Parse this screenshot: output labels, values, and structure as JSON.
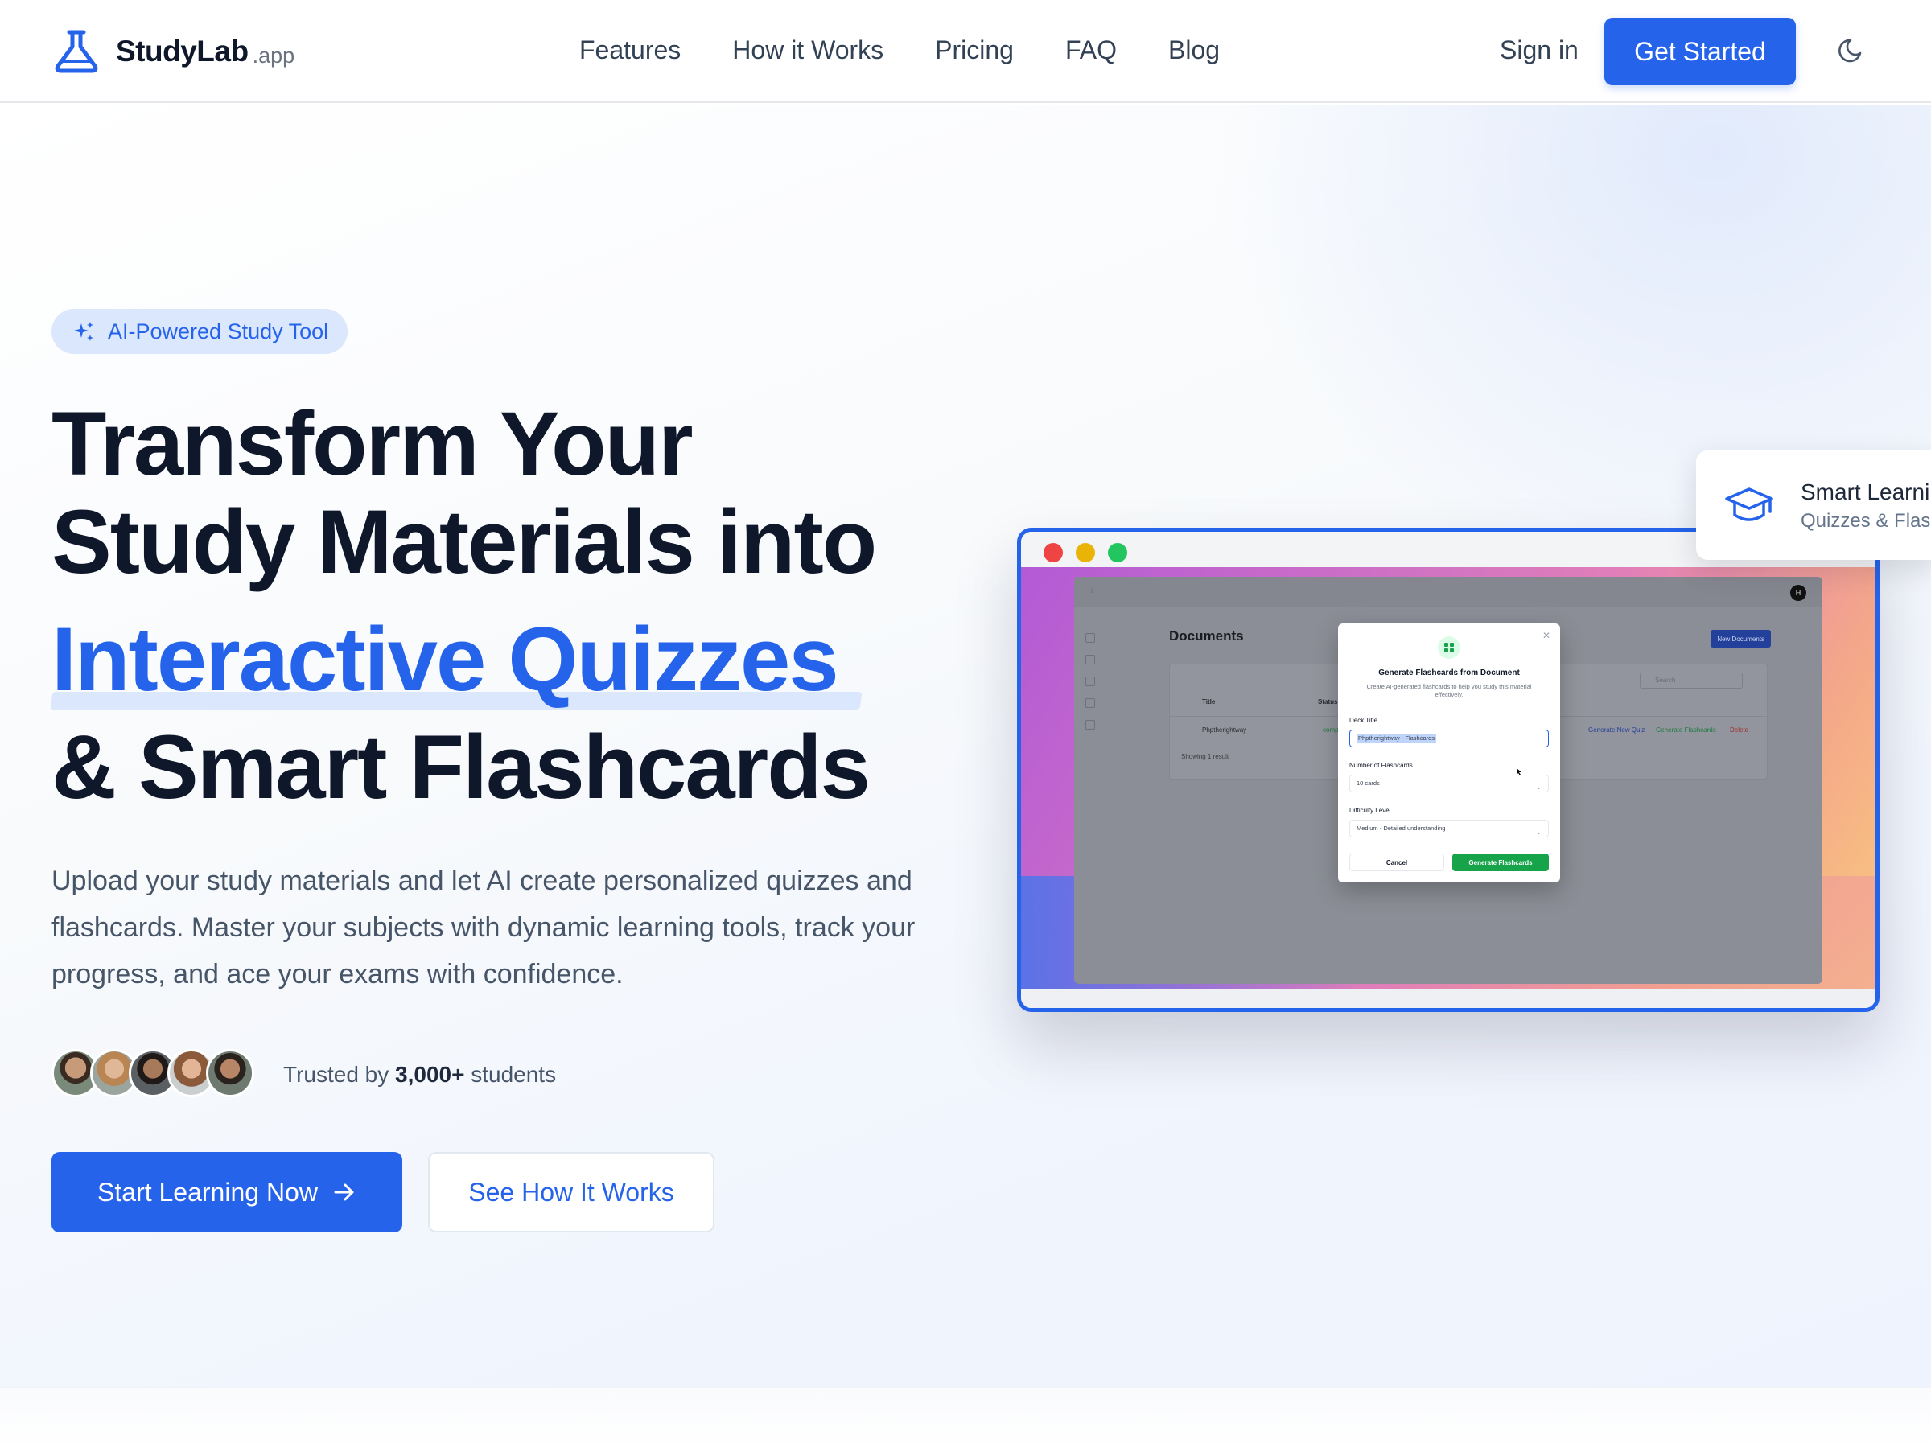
{
  "brand": {
    "name": "StudyLab",
    "tld": ".app"
  },
  "nav": {
    "links": [
      "Features",
      "How it Works",
      "Pricing",
      "FAQ",
      "Blog"
    ],
    "signin": "Sign in",
    "cta": "Get Started"
  },
  "hero": {
    "badge": "AI-Powered Study Tool",
    "title_line1": "Transform Your",
    "title_line2": "Study Materials into",
    "title_highlight": "Interactive Quizzes",
    "title_line4": "& Smart Flashcards",
    "subtitle": "Upload your study materials and let AI create personalized quizzes and flashcards. Master your subjects with dynamic learning tools, track your progress, and ace your exams with confidence.",
    "trusted_prefix": "Trusted by",
    "trusted_count": "3,000+",
    "trusted_suffix": "students",
    "primary_button": "Start Learning Now",
    "secondary_button": "See How It Works"
  },
  "preview": {
    "page_title": "Documents",
    "new_button": "New Documents",
    "search_placeholder": "Search",
    "col_title": "Title",
    "col_status": "Status",
    "row_title": "Phptherightway",
    "row_status": "compl",
    "action_quiz": "Generate New Quiz",
    "action_flash": "Generate Flashcards",
    "action_delete": "Delete",
    "showing": "Showing 1 result",
    "avatar_initial": "H",
    "modal": {
      "title": "Generate Flashcards from Document",
      "description": "Create AI-generated flashcards to help you study this material effectively.",
      "deck_label": "Deck Title",
      "deck_value": "Phptherightway - Flashcards",
      "count_label": "Number of Flashcards",
      "count_value": "10 cards",
      "difficulty_label": "Difficulty Level",
      "difficulty_value": "Medium - Detailed understanding",
      "cancel": "Cancel",
      "generate": "Generate Flashcards"
    }
  },
  "float_card": {
    "title": "Smart Learning",
    "subtitle": "Quizzes & Flashcards"
  },
  "colors": {
    "primary": "#2563eb",
    "highlight_bg": "#dbe7fd",
    "text_dark": "#0f172a"
  },
  "icons": [
    "flask-icon",
    "moon-icon",
    "sparkles-icon",
    "arrow-right-icon",
    "graduation-cap-icon"
  ]
}
